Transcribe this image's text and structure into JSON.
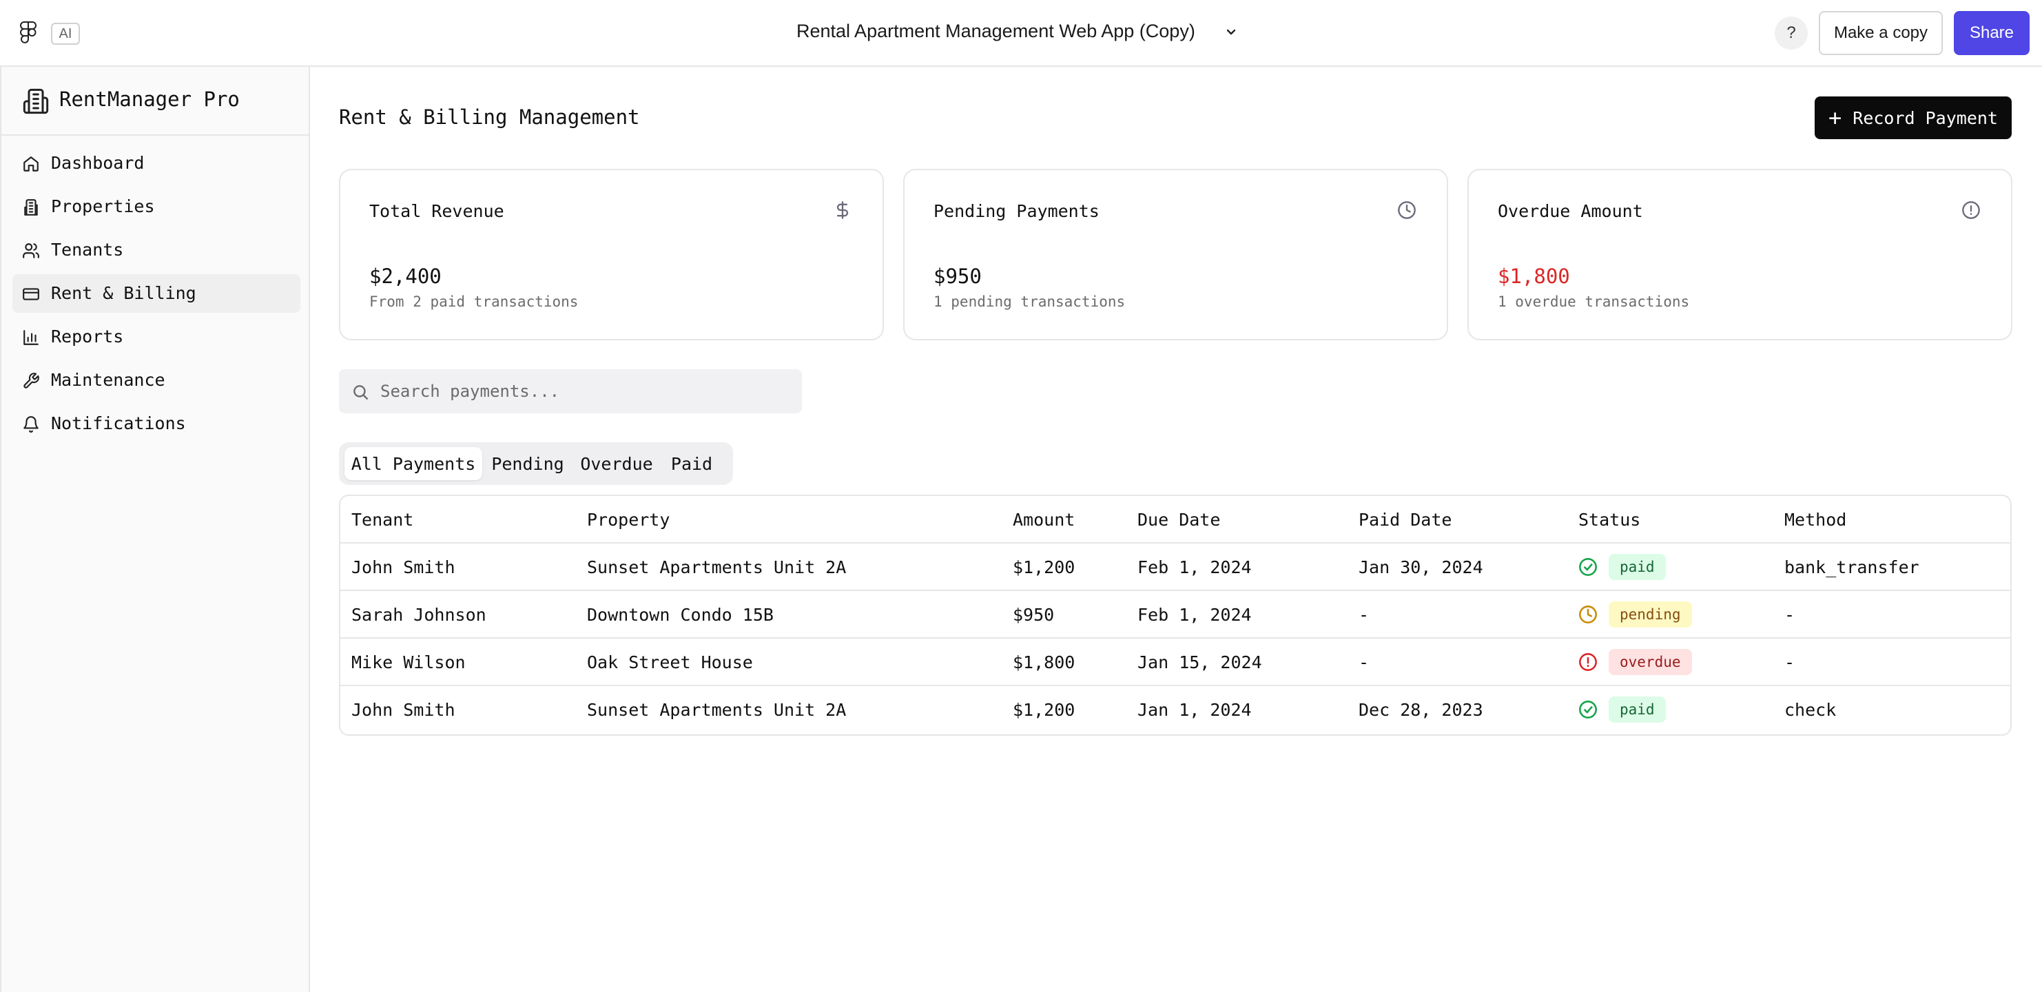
{
  "topbar": {
    "ai_label": "AI",
    "document_title": "Rental Apartment Management Web App (Copy)",
    "help_label": "?",
    "make_copy_label": "Make a copy",
    "share_label": "Share",
    "accent_color": "#4f46e5"
  },
  "sidebar": {
    "app_name": "RentManager Pro",
    "items": [
      {
        "label": "Dashboard",
        "icon": "home-icon"
      },
      {
        "label": "Properties",
        "icon": "building-icon"
      },
      {
        "label": "Tenants",
        "icon": "users-icon"
      },
      {
        "label": "Rent & Billing",
        "icon": "credit-card-icon",
        "active": true
      },
      {
        "label": "Reports",
        "icon": "bar-chart-icon"
      },
      {
        "label": "Maintenance",
        "icon": "wrench-icon"
      },
      {
        "label": "Notifications",
        "icon": "bell-icon"
      }
    ]
  },
  "main": {
    "title": "Rent & Billing Management",
    "record_payment_label": "Record Payment",
    "cards": [
      {
        "title": "Total Revenue",
        "value": "$2,400",
        "subtitle": "From 2 paid transactions",
        "icon": "dollar-icon"
      },
      {
        "title": "Pending Payments",
        "value": "$950",
        "subtitle": "1 pending transactions",
        "icon": "clock-icon"
      },
      {
        "title": "Overdue Amount",
        "value": "$1,800",
        "subtitle": "1 overdue transactions",
        "icon": "alert-circle-icon",
        "value_color": "#dc2626"
      }
    ],
    "search": {
      "placeholder": "Search payments...",
      "value": ""
    },
    "tabs": [
      {
        "label": "All Payments",
        "active": true
      },
      {
        "label": "Pending"
      },
      {
        "label": "Overdue"
      },
      {
        "label": "Paid"
      }
    ],
    "table": {
      "columns": [
        "Tenant",
        "Property",
        "Amount",
        "Due Date",
        "Paid Date",
        "Status",
        "Method"
      ],
      "rows": [
        {
          "tenant": "John Smith",
          "property": "Sunset Apartments Unit 2A",
          "amount": "$1,200",
          "due_date": "Feb 1, 2024",
          "paid_date": "Jan 30, 2024",
          "status": "paid",
          "method": "bank_transfer"
        },
        {
          "tenant": "Sarah Johnson",
          "property": "Downtown Condo 15B",
          "amount": "$950",
          "due_date": "Feb 1, 2024",
          "paid_date": "-",
          "status": "pending",
          "method": "-"
        },
        {
          "tenant": "Mike Wilson",
          "property": "Oak Street House",
          "amount": "$1,800",
          "due_date": "Jan 15, 2024",
          "paid_date": "-",
          "status": "overdue",
          "method": "-"
        },
        {
          "tenant": "John Smith",
          "property": "Sunset Apartments Unit 2A",
          "amount": "$1,200",
          "due_date": "Jan 1, 2024",
          "paid_date": "Dec 28, 2023",
          "status": "paid",
          "method": "check"
        }
      ]
    },
    "status_colors": {
      "paid": "#16a34a",
      "pending": "#ca8a04",
      "overdue": "#dc2626"
    }
  }
}
